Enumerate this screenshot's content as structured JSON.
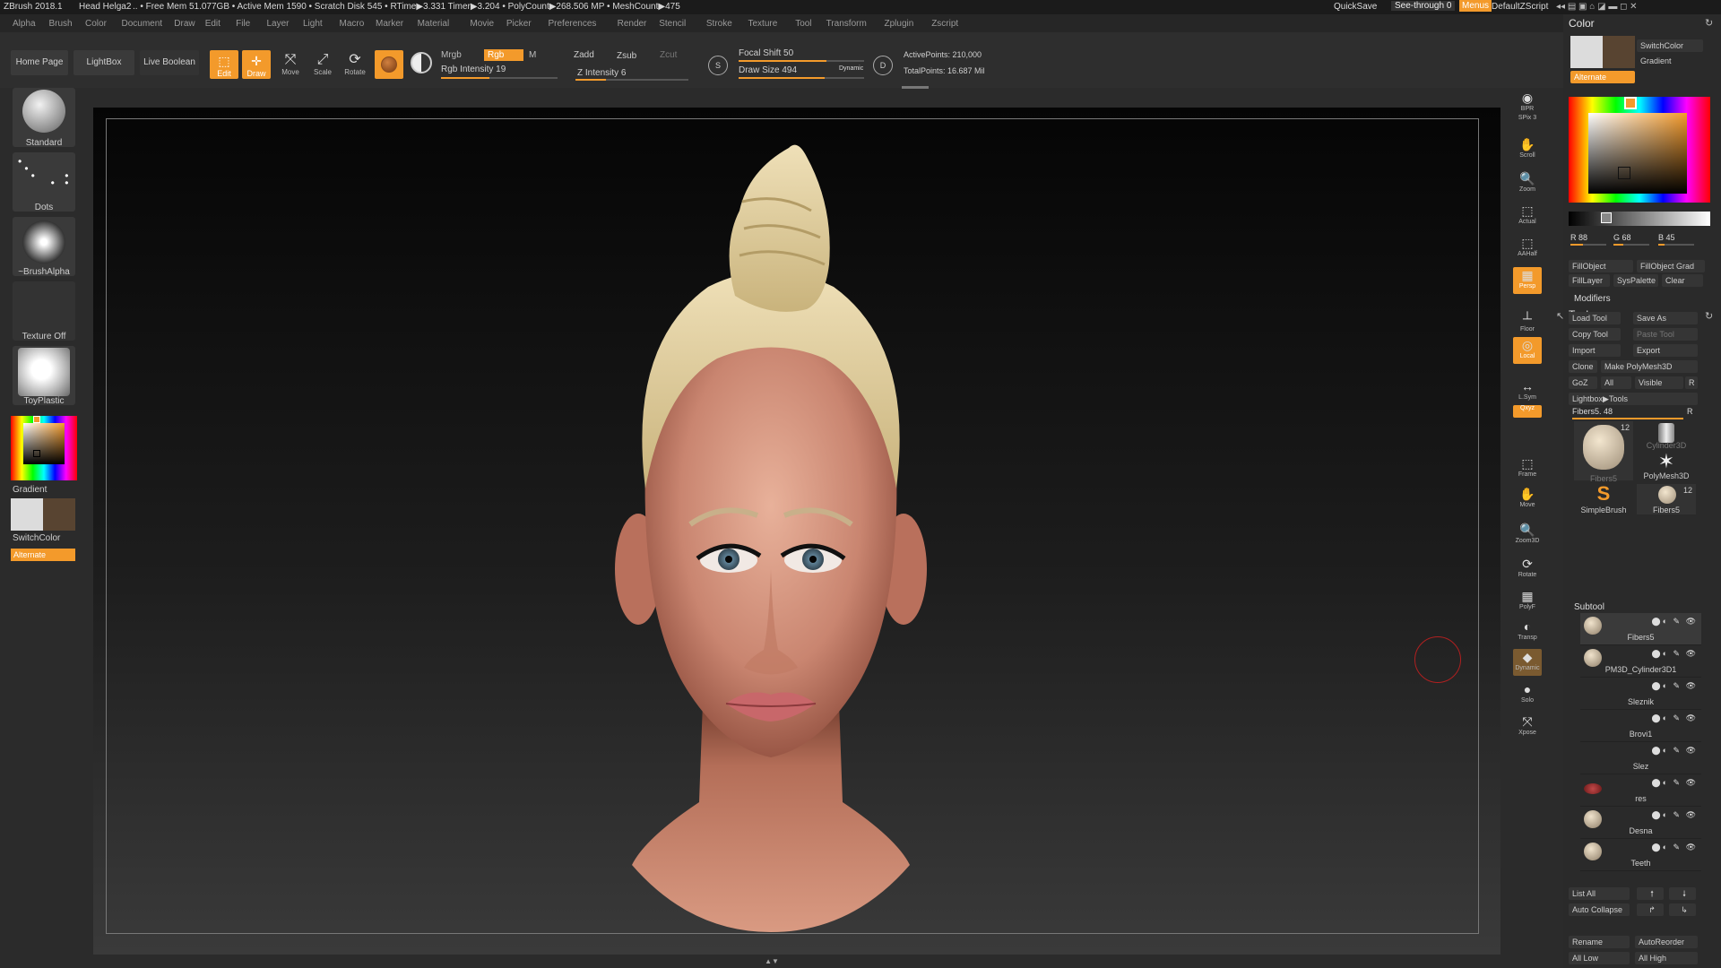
{
  "title_bar": {
    "app": "ZBrush 2018.1",
    "doc": "Head Helga2",
    "stats": ".. • Free Mem 51.077GB • Active Mem 1590 • Scratch Disk 545 • RTime▶3.331 Timer▶3.204 • PolyCount▶268.506 MP • MeshCount▶475",
    "quicksave": "QuickSave",
    "see_through": "See-through",
    "see_through_value": "0",
    "menus": "Menus",
    "default_zscript": "DefaultZScript"
  },
  "menu_bar": [
    "Alpha",
    "Brush",
    "Color",
    "Document",
    "Draw",
    "Edit",
    "File",
    "Layer",
    "Light",
    "Macro",
    "Marker",
    "Material",
    "Movie",
    "Picker",
    "Preferences",
    "Render",
    "Stencil",
    "Stroke",
    "Texture",
    "Tool",
    "Transform",
    "Zplugin",
    "Zscript"
  ],
  "top_shelf": {
    "home_page": "Home Page",
    "lightbox": "LightBox",
    "live_boolean": "Live Boolean",
    "edit": "Edit",
    "draw": "Draw",
    "move": "Move",
    "scale": "Scale",
    "rotate": "Rotate",
    "mrgb": "Mrgb",
    "rgb": "Rgb",
    "m": "M",
    "rgb_intensity_label": "Rgb Intensity",
    "rgb_intensity": 19,
    "zadd": "Zadd",
    "zsub": "Zsub",
    "zcut": "Zcut",
    "z_intensity_label": "Z Intensity",
    "z_intensity": 6,
    "focal_shift_label": "Focal Shift",
    "focal_shift": 50,
    "draw_size_label": "Draw Size",
    "draw_size": 494,
    "dynamic": "Dynamic",
    "active_points": "ActivePoints: 210,000",
    "total_points": "TotalPoints: 16.687 Mil"
  },
  "left_shelf": {
    "brush": "Standard",
    "stroke": "Dots",
    "alpha": "~BrushAlpha",
    "texture": "Texture Off",
    "material": "ToyPlastic",
    "gradient": "Gradient",
    "switch_color": "SwitchColor",
    "alternate": "Alternate"
  },
  "right_shelf": [
    {
      "name": "bpr",
      "label": "BPR"
    },
    {
      "name": "spix",
      "label": "SPix 3"
    },
    {
      "name": "scroll",
      "label": "Scroll"
    },
    {
      "name": "zoom",
      "label": "Zoom"
    },
    {
      "name": "actual",
      "label": "Actual"
    },
    {
      "name": "aahalf",
      "label": "AAHalf"
    },
    {
      "name": "persp",
      "label": "Persp"
    },
    {
      "name": "floor",
      "label": "Floor"
    },
    {
      "name": "local",
      "label": "Local"
    },
    {
      "name": "lsym",
      "label": "L.Sym"
    },
    {
      "name": "xyz",
      "label": "Qxyz"
    },
    {
      "name": "frame",
      "label": "Frame"
    },
    {
      "name": "move",
      "label": "Move"
    },
    {
      "name": "zoom3d",
      "label": "Zoom3D"
    },
    {
      "name": "rotate",
      "label": "Rotate"
    },
    {
      "name": "polyf",
      "label": "PolyF"
    },
    {
      "name": "transp",
      "label": "Transp"
    },
    {
      "name": "dynamic",
      "label": "Dynamic"
    },
    {
      "name": "solo",
      "label": "Solo"
    },
    {
      "name": "xpose",
      "label": "Xpose"
    }
  ],
  "color_panel": {
    "title": "Color",
    "switch_color": "SwitchColor",
    "gradient": "Gradient",
    "alternate": "Alternate",
    "r": "R 88",
    "g": "G 68",
    "b": "B 45",
    "fill_object": "FillObject",
    "fill_object_grad": "FillObject Grad",
    "fill_layer": "FillLayer",
    "sys_palette": "SysPalette",
    "clear": "Clear",
    "modifiers": "Modifiers",
    "main_color": "#dcdcdc",
    "secondary_color": "#584431"
  },
  "tool_panel": {
    "title": "Tool",
    "load_tool": "Load Tool",
    "save_as": "Save As",
    "copy_tool": "Copy Tool",
    "paste_tool": "Paste Tool",
    "import": "Import",
    "export": "Export",
    "clone": "Clone",
    "make_polymesh": "Make PolyMesh3D",
    "goz": "GoZ",
    "all": "All",
    "visible": "Visible",
    "r": "R",
    "lightbox_tools": "Lightbox▶Tools",
    "fibers_slider": "Fibers5. 48",
    "tools": [
      {
        "name": "Fibers5",
        "count": "12"
      },
      {
        "name": "Cylinder3D",
        "count": ""
      },
      {
        "name": "PolyMesh3D",
        "count": ""
      },
      {
        "name": "SimpleBrush",
        "count": ""
      },
      {
        "name": "Fibers5",
        "count": "12"
      }
    ],
    "subtool_title": "Subtool",
    "subtools": [
      "Fibers5",
      "PM3D_Cylinder3D1",
      "Sleznik",
      "Brovi1",
      "Slez",
      "res",
      "Desna",
      "Teeth"
    ],
    "list_all": "List All",
    "auto_collapse": "Auto Collapse",
    "rename": "Rename",
    "auto_reorder": "AutoReorder",
    "all_low": "All Low",
    "all_high": "All High"
  },
  "accent": "#f39a2b"
}
